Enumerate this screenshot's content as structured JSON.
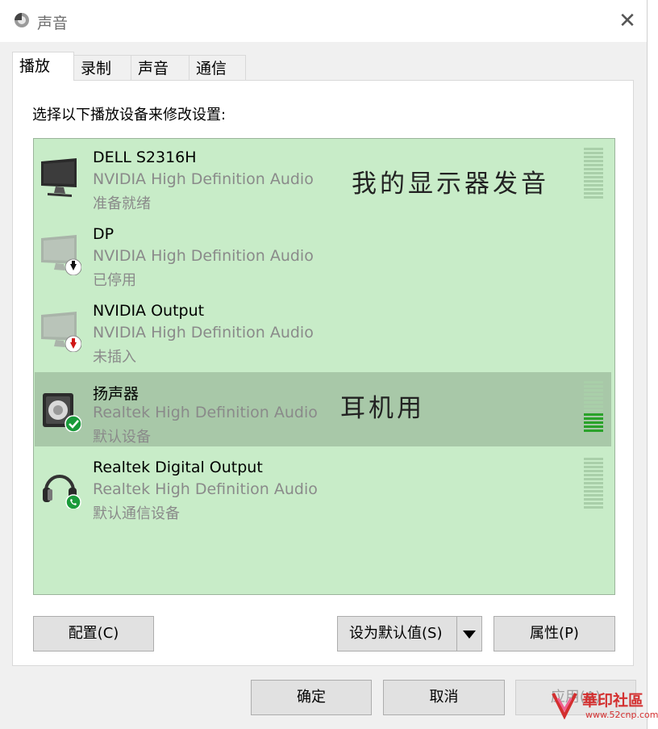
{
  "window": {
    "title": "声音",
    "close": "✕"
  },
  "tabs": [
    {
      "label": "播放",
      "active": true
    },
    {
      "label": "录制",
      "active": false
    },
    {
      "label": "声音",
      "active": false
    },
    {
      "label": "通信",
      "active": false
    }
  ],
  "instruction": "选择以下播放设备来修改设置:",
  "devices": [
    {
      "name": "DELL S2316H",
      "driver": "NVIDIA High Definition Audio",
      "status": "准备就绪",
      "icon": "monitor-icon",
      "badge": "",
      "selected": false,
      "meter_level": 0
    },
    {
      "name": "DP",
      "driver": "NVIDIA High Definition Audio",
      "status": "已停用",
      "icon": "monitor-icon",
      "badge": "disabled-arrow",
      "selected": false
    },
    {
      "name": "NVIDIA Output",
      "driver": "NVIDIA High Definition Audio",
      "status": "未插入",
      "icon": "monitor-icon",
      "badge": "unplugged-arrow",
      "selected": false
    },
    {
      "name": "扬声器",
      "driver": "Realtek High Definition Audio",
      "status": "默认设备",
      "icon": "speaker-icon",
      "badge": "default-check",
      "selected": true,
      "meter_level": 0.4
    },
    {
      "name": "Realtek Digital Output",
      "driver": "Realtek High Definition Audio",
      "status": "默认通信设备",
      "icon": "headphones-icon",
      "badge": "phone",
      "selected": false,
      "meter_level": 0
    }
  ],
  "annotations": {
    "monitor": "我的显示器发音",
    "headphones": "耳机用"
  },
  "buttons": {
    "configure": "配置(C)",
    "set_default": "设为默认值(S)",
    "properties": "属性(P)",
    "ok": "确定",
    "cancel": "取消",
    "apply": "应用(A)"
  },
  "watermark": {
    "text": "華印社區",
    "url": "www.52cnp.com"
  },
  "colors": {
    "list_bg": "#c8ecc8",
    "selected_bg": "#a8c8a8",
    "meter_on": "#2aa22a",
    "meter_off": "#a9cfa9",
    "watermark": "#d32f2f"
  }
}
